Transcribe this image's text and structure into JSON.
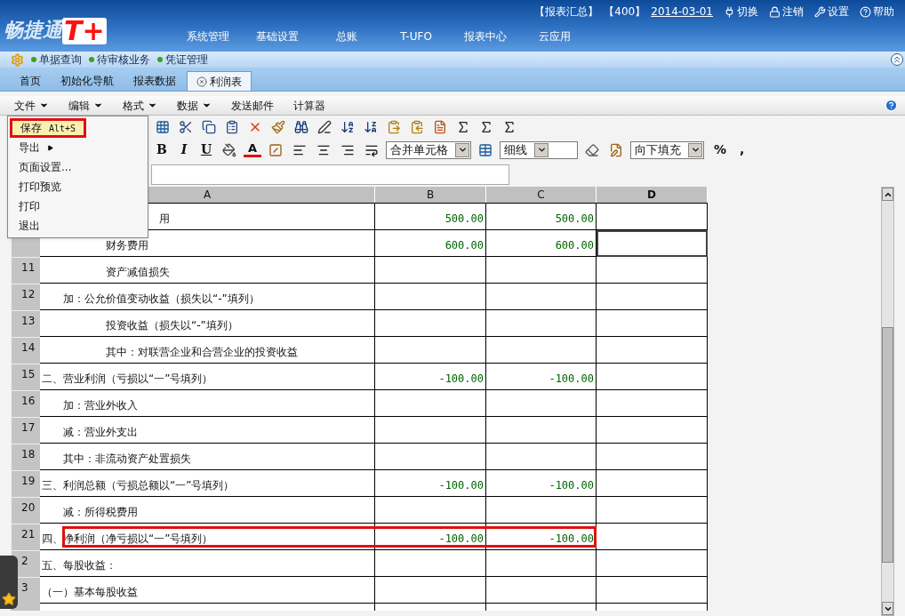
{
  "header": {
    "logo": {
      "text": "畅捷通",
      "mark": "T+"
    },
    "info": [
      {
        "text": "【报表汇总】",
        "kind": "text"
      },
      {
        "text": "【400】",
        "kind": "text"
      },
      {
        "text": "2014-03-01",
        "kind": "link"
      }
    ],
    "actions": [
      "切换",
      "注销",
      "设置",
      "帮助"
    ],
    "nav": [
      "系统管理",
      "基础设置",
      "总账",
      "T-UFO",
      "报表中心",
      "云应用"
    ]
  },
  "quick_bar": [
    "单据查询",
    "待审核业务",
    "凭证管理"
  ],
  "tabs": [
    {
      "label": "首页",
      "selected": false,
      "closable": false
    },
    {
      "label": "初始化导航",
      "selected": false,
      "closable": false
    },
    {
      "label": "报表数据",
      "selected": false,
      "closable": false
    },
    {
      "label": "利润表",
      "selected": true,
      "closable": true
    }
  ],
  "menu_bar": [
    {
      "label": "文件",
      "has_dropdown": true
    },
    {
      "label": "编辑",
      "has_dropdown": true
    },
    {
      "label": "格式",
      "has_dropdown": true
    },
    {
      "label": "数据",
      "has_dropdown": true
    },
    {
      "label": "发送邮件",
      "has_dropdown": false
    },
    {
      "label": "计算器",
      "has_dropdown": false
    }
  ],
  "file_menu": [
    {
      "label": "保存",
      "shortcut": "Alt+S",
      "highlighted": true,
      "submenu": false
    },
    {
      "label": "导出",
      "highlighted": false,
      "submenu": true
    },
    {
      "label": "页面设置...",
      "highlighted": false,
      "submenu": false
    },
    {
      "label": "打印预览",
      "highlighted": false,
      "submenu": false
    },
    {
      "label": "打印",
      "highlighted": false,
      "submenu": false
    },
    {
      "label": "退出",
      "highlighted": false,
      "submenu": false
    }
  ],
  "format_toolbar": {
    "bold": "B",
    "italic": "I",
    "underline": "U",
    "font_color": "A",
    "merge_select": "合并单元格",
    "border_select": "细线",
    "fill_select": "向下填充",
    "percent": "%",
    "comma": ","
  },
  "sheet": {
    "columns": [
      "A",
      "B",
      "C",
      "D"
    ],
    "rows": [
      {
        "label": "　　　　　　　　　　　用",
        "b": "500.00",
        "c": "500.00",
        "selected_d": false,
        "highlighted": false
      },
      {
        "label": "　　　　　　财务费用",
        "b": "600.00",
        "c": "600.00",
        "selected_d": true,
        "highlighted": false
      },
      {
        "number": "11",
        "label": "　　　　　　资产减值损失",
        "selected_d": false,
        "highlighted": false
      },
      {
        "number": "12",
        "label": "　　加：公允价值变动收益（损失以“-”填列）",
        "selected_d": false,
        "highlighted": false
      },
      {
        "number": "13",
        "label": "　　　　　　投资收益（损失以“-”填列）",
        "selected_d": false,
        "highlighted": false
      },
      {
        "number": "14",
        "label": "　　　　　　其中：对联营企业和合营企业的投资收益",
        "selected_d": false,
        "highlighted": false
      },
      {
        "number": "15",
        "label": "二、营业利润（亏损以“一”号填列）",
        "b": "-100.00",
        "c": "-100.00",
        "selected_d": false,
        "highlighted": false
      },
      {
        "number": "16",
        "label": "　　加：营业外收入",
        "selected_d": false,
        "highlighted": false
      },
      {
        "number": "17",
        "label": "　　减：营业外支出",
        "selected_d": false,
        "highlighted": false
      },
      {
        "number": "18",
        "label": "　　其中：非流动资产处置损失",
        "selected_d": false,
        "highlighted": false
      },
      {
        "number": "19",
        "label": "三、利润总额（亏损总额以“一”号填列）",
        "b": "-100.00",
        "c": "-100.00",
        "selected_d": false,
        "highlighted": false
      },
      {
        "number": "20",
        "label": "　　减：所得税费用",
        "selected_d": false,
        "highlighted": false
      },
      {
        "number": "21",
        "label": "四、净利润（净亏损以“一”号填列）",
        "b": "-100.00",
        "c": "-100.00",
        "selected_d": false,
        "highlighted": true
      },
      {
        "number": "2",
        "label": "五、每股收益：",
        "selected_d": false,
        "highlighted": false
      },
      {
        "number": "3",
        "label": "（一）基本每股收益",
        "selected_d": false,
        "highlighted": false
      }
    ]
  }
}
